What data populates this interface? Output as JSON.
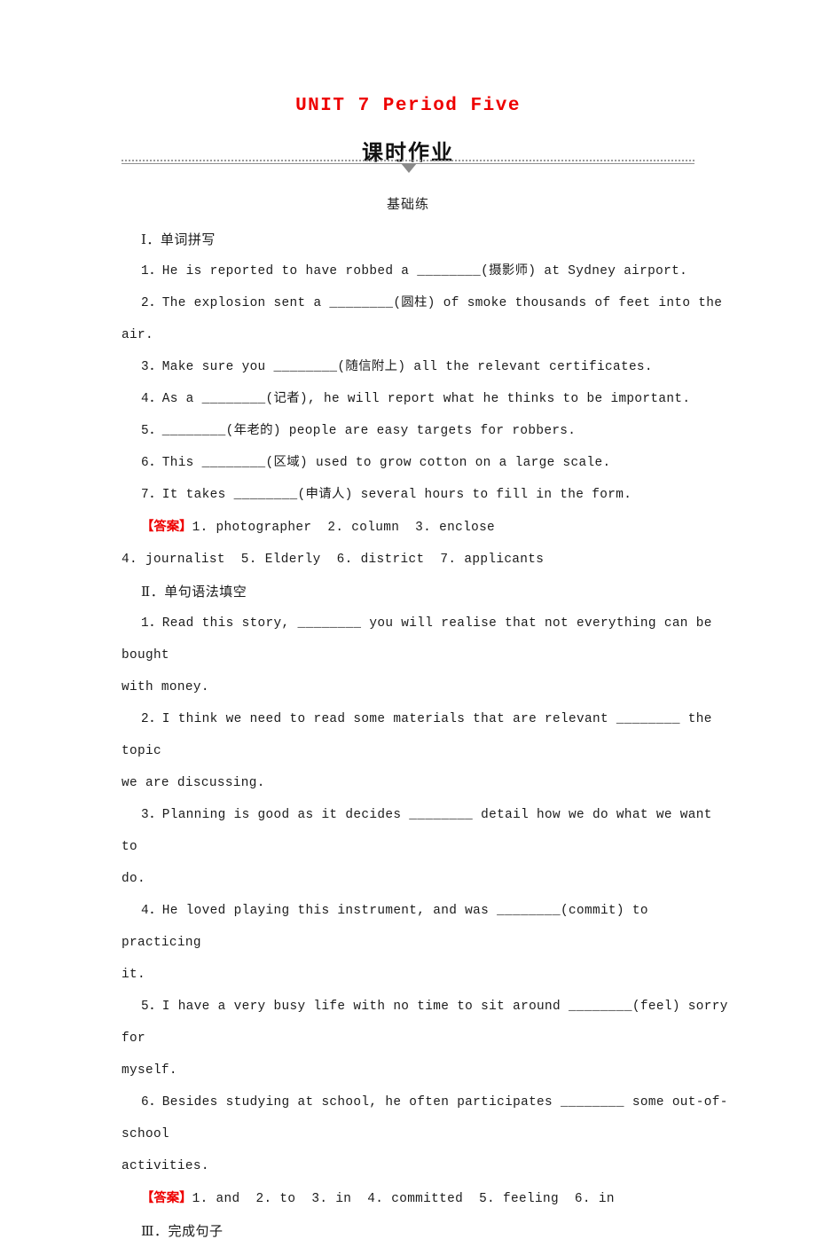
{
  "header": {
    "unit_title": "UNIT 7  Period Five",
    "cn_title": "课时作业",
    "section_badge": "基础练"
  },
  "colors": {
    "title_red": "#ee0000",
    "answer_red": "#ee0000",
    "body_black": "#1b1b1b",
    "divider_gray": "#8e8e8e"
  },
  "sections": [
    {
      "heading": "Ⅰ．单词拼写",
      "lines": [
        "1．He is reported to have robbed a ________(摄影师) at Sydney airport.",
        "2．The explosion sent a ________(圆柱) of smoke thousands of feet into the",
        "air.",
        "3．Make sure you ________(随信附上) all the relevant certificates.",
        "4．As a ________(记者), he will report what he thinks to be important.",
        "5．________(年老的) people are easy targets for robbers.",
        "6．This ________(区域) used to grow cotton on a large scale.",
        "7．It takes ________(申请人) several hours to fill in the form."
      ],
      "answer_tag": "【答案】",
      "answer_lines": [
        "1. photographer  2. column  3. enclose",
        "4. journalist  5. Elderly  6. district  7. applicants"
      ]
    },
    {
      "heading": "Ⅱ．单句语法填空",
      "lines": [
        "1．Read this story, ________ you will realise that not everything can be bought",
        "with money.",
        "2．I think we need to read some materials that are relevant ________ the topic",
        "we are discussing.",
        "3．Planning is good as it decides ________ detail how we do what we want to",
        "do.",
        "4．He loved playing this instrument, and was ________(commit) to practicing",
        "it.",
        "5．I have a very busy life with no time to sit around ________(feel) sorry for",
        "myself.",
        "6．Besides studying at school, he often participates ________ some out-of-school",
        "activities."
      ],
      "answer_tag": "【答案】",
      "answer_lines": [
        "1. and  2. to  3. in  4. committed  5. feeling  6. in"
      ]
    },
    {
      "heading": "Ⅲ．完成句子",
      "lines": [],
      "answer_tag": "",
      "answer_lines": []
    }
  ]
}
